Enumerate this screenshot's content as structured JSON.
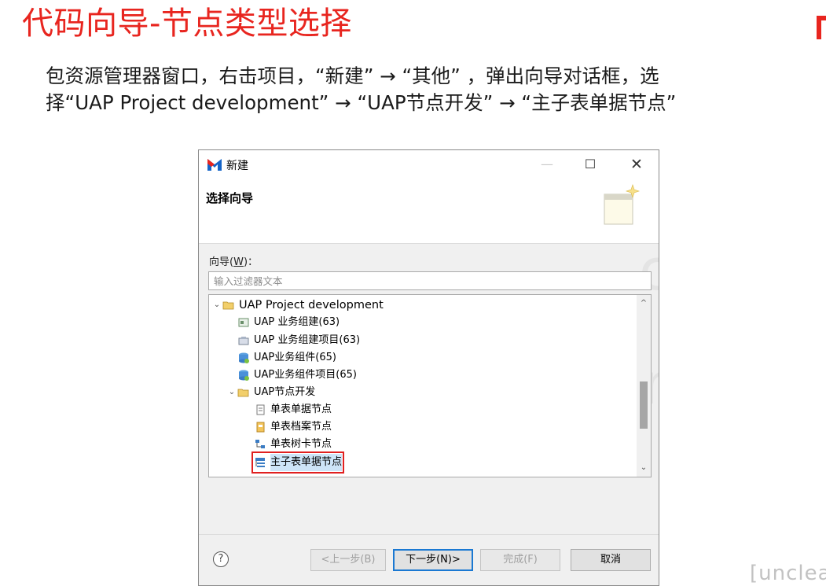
{
  "slide": {
    "title": "代码向导-节点类型选择",
    "instruction_line1": "包资源管理器窗口，右击项目，“新建” → “其他” ，弹出向导对话框，选",
    "instruction_line2": "择“UAP Project development” → “UAP节点开发” → “主子表单据节点”",
    "watermark_text": "[unclear]"
  },
  "dialog": {
    "title": "新建",
    "window_buttons": {
      "minimize": "—",
      "maximize": "☐",
      "close": "✕"
    },
    "banner_title": "选择向导",
    "wizard_label": "向导(W)：",
    "wizard_label_pre": "向导(",
    "wizard_label_key": "W",
    "wizard_label_post": ")：",
    "filter_placeholder": "输入过滤器文本",
    "tree": [
      {
        "label": "UAP Project development",
        "icon": "folder-icon",
        "level": 0,
        "expanded": true
      },
      {
        "label": "UAP 业务组建(63)",
        "icon": "component-icon",
        "level": 1
      },
      {
        "label": "UAP 业务组建项目(63)",
        "icon": "project-icon",
        "level": 1
      },
      {
        "label": "UAP业务组件(65)",
        "icon": "database-icon",
        "level": 1
      },
      {
        "label": "UAP业务组件项目(65)",
        "icon": "database-icon",
        "level": 1
      },
      {
        "label": "UAP节点开发",
        "icon": "folder-icon",
        "level": 1,
        "expanded": true
      },
      {
        "label": "单表单据节点",
        "icon": "document-icon",
        "level": 2
      },
      {
        "label": "单表档案节点",
        "icon": "archive-icon",
        "level": 2
      },
      {
        "label": "单表树卡节点",
        "icon": "tree-card-icon",
        "level": 2
      },
      {
        "label": "主子表单据节点",
        "icon": "master-detail-icon",
        "level": 2,
        "selected": true
      }
    ],
    "buttons": {
      "help": "?",
      "back": "<上一步(B)",
      "next": "下一步(N)>",
      "finish": "完成(F)",
      "cancel": "取消"
    }
  },
  "colors": {
    "title_red": "#e8251f",
    "highlight_red": "#e02020",
    "default_button_border": "#1a78d2"
  }
}
